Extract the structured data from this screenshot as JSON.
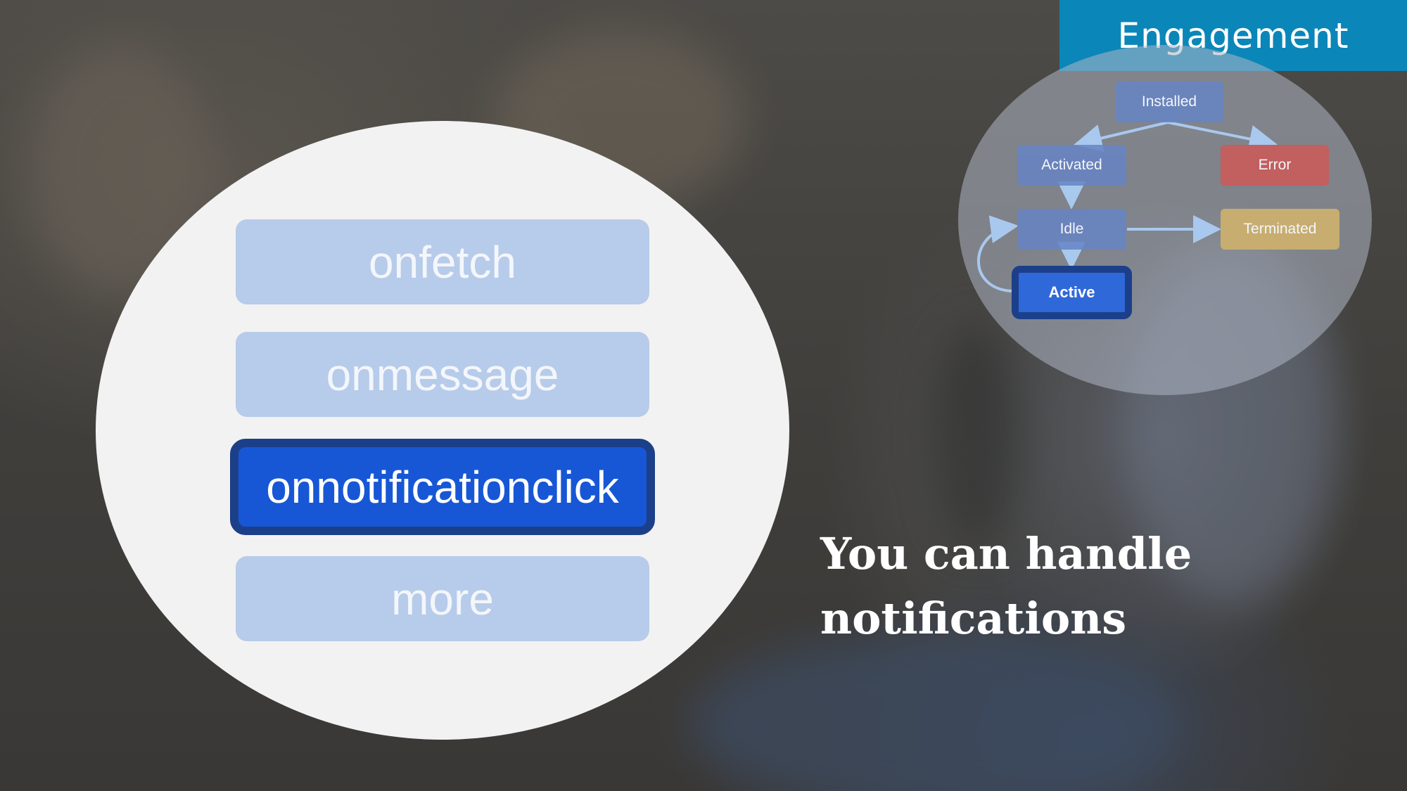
{
  "header": {
    "section_label": "Engagement"
  },
  "handlers": [
    {
      "label": "onfetch",
      "active": false
    },
    {
      "label": "onmessage",
      "active": false
    },
    {
      "label": "onnotificationclick",
      "active": true
    },
    {
      "label": "more",
      "active": false
    }
  ],
  "caption": {
    "line1": "You can handle",
    "line2": "notifications"
  },
  "lifecycle": {
    "states": {
      "installed": "Installed",
      "activated": "Activated",
      "error": "Error",
      "idle": "Idle",
      "terminated": "Terminated",
      "active": "Active"
    },
    "current_state": "Active"
  },
  "colors": {
    "tab": "#0b86b8",
    "handler_fill": "#b7cbea",
    "handler_active_fill": "#1757d6",
    "handler_active_border": "#1c3f8a",
    "state_blue": "#6684c4",
    "state_error": "#c25f5f",
    "state_terminated": "#c7ad70",
    "arrow": "#a9c8ee"
  }
}
